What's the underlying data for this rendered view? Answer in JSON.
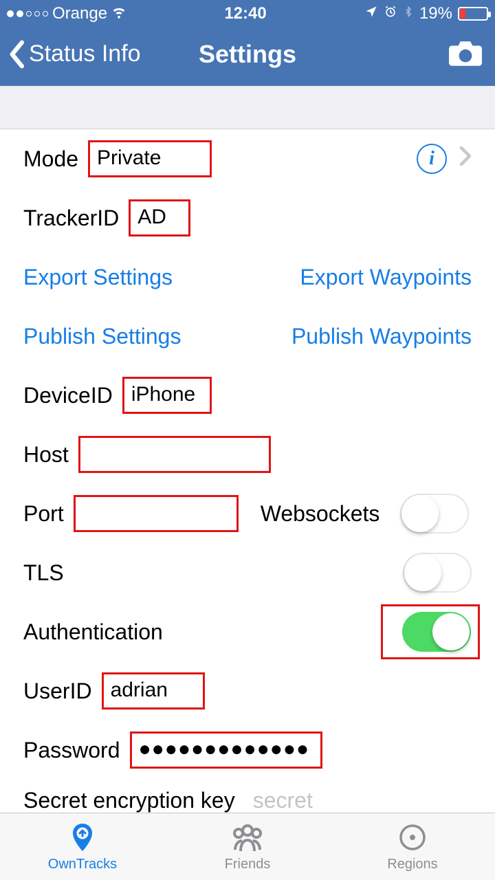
{
  "status": {
    "carrier": "Orange",
    "time": "12:40",
    "battery_percent": "19%"
  },
  "nav": {
    "back_label": "Status Info",
    "title": "Settings"
  },
  "rows": {
    "mode_label": "Mode",
    "mode_value": "Private",
    "tracker_label": "TrackerID",
    "tracker_value": "AD",
    "export_settings": "Export Settings",
    "export_waypoints": "Export Waypoints",
    "publish_settings": "Publish Settings",
    "publish_waypoints": "Publish Waypoints",
    "device_label": "DeviceID",
    "device_value": "iPhone",
    "host_label": "Host",
    "host_value": "",
    "port_label": "Port",
    "port_value": "",
    "websockets_label": "Websockets",
    "websockets_on": false,
    "tls_label": "TLS",
    "tls_on": false,
    "auth_label": "Authentication",
    "auth_on": true,
    "user_label": "UserID",
    "user_value": "adrian",
    "password_label": "Password",
    "password_value": "●●●●●●●●●●●●●",
    "secret_label": "Secret encryption key",
    "secret_placeholder": "secret"
  },
  "tabs": {
    "owntracks": "OwnTracks",
    "friends": "Friends",
    "regions": "Regions"
  }
}
